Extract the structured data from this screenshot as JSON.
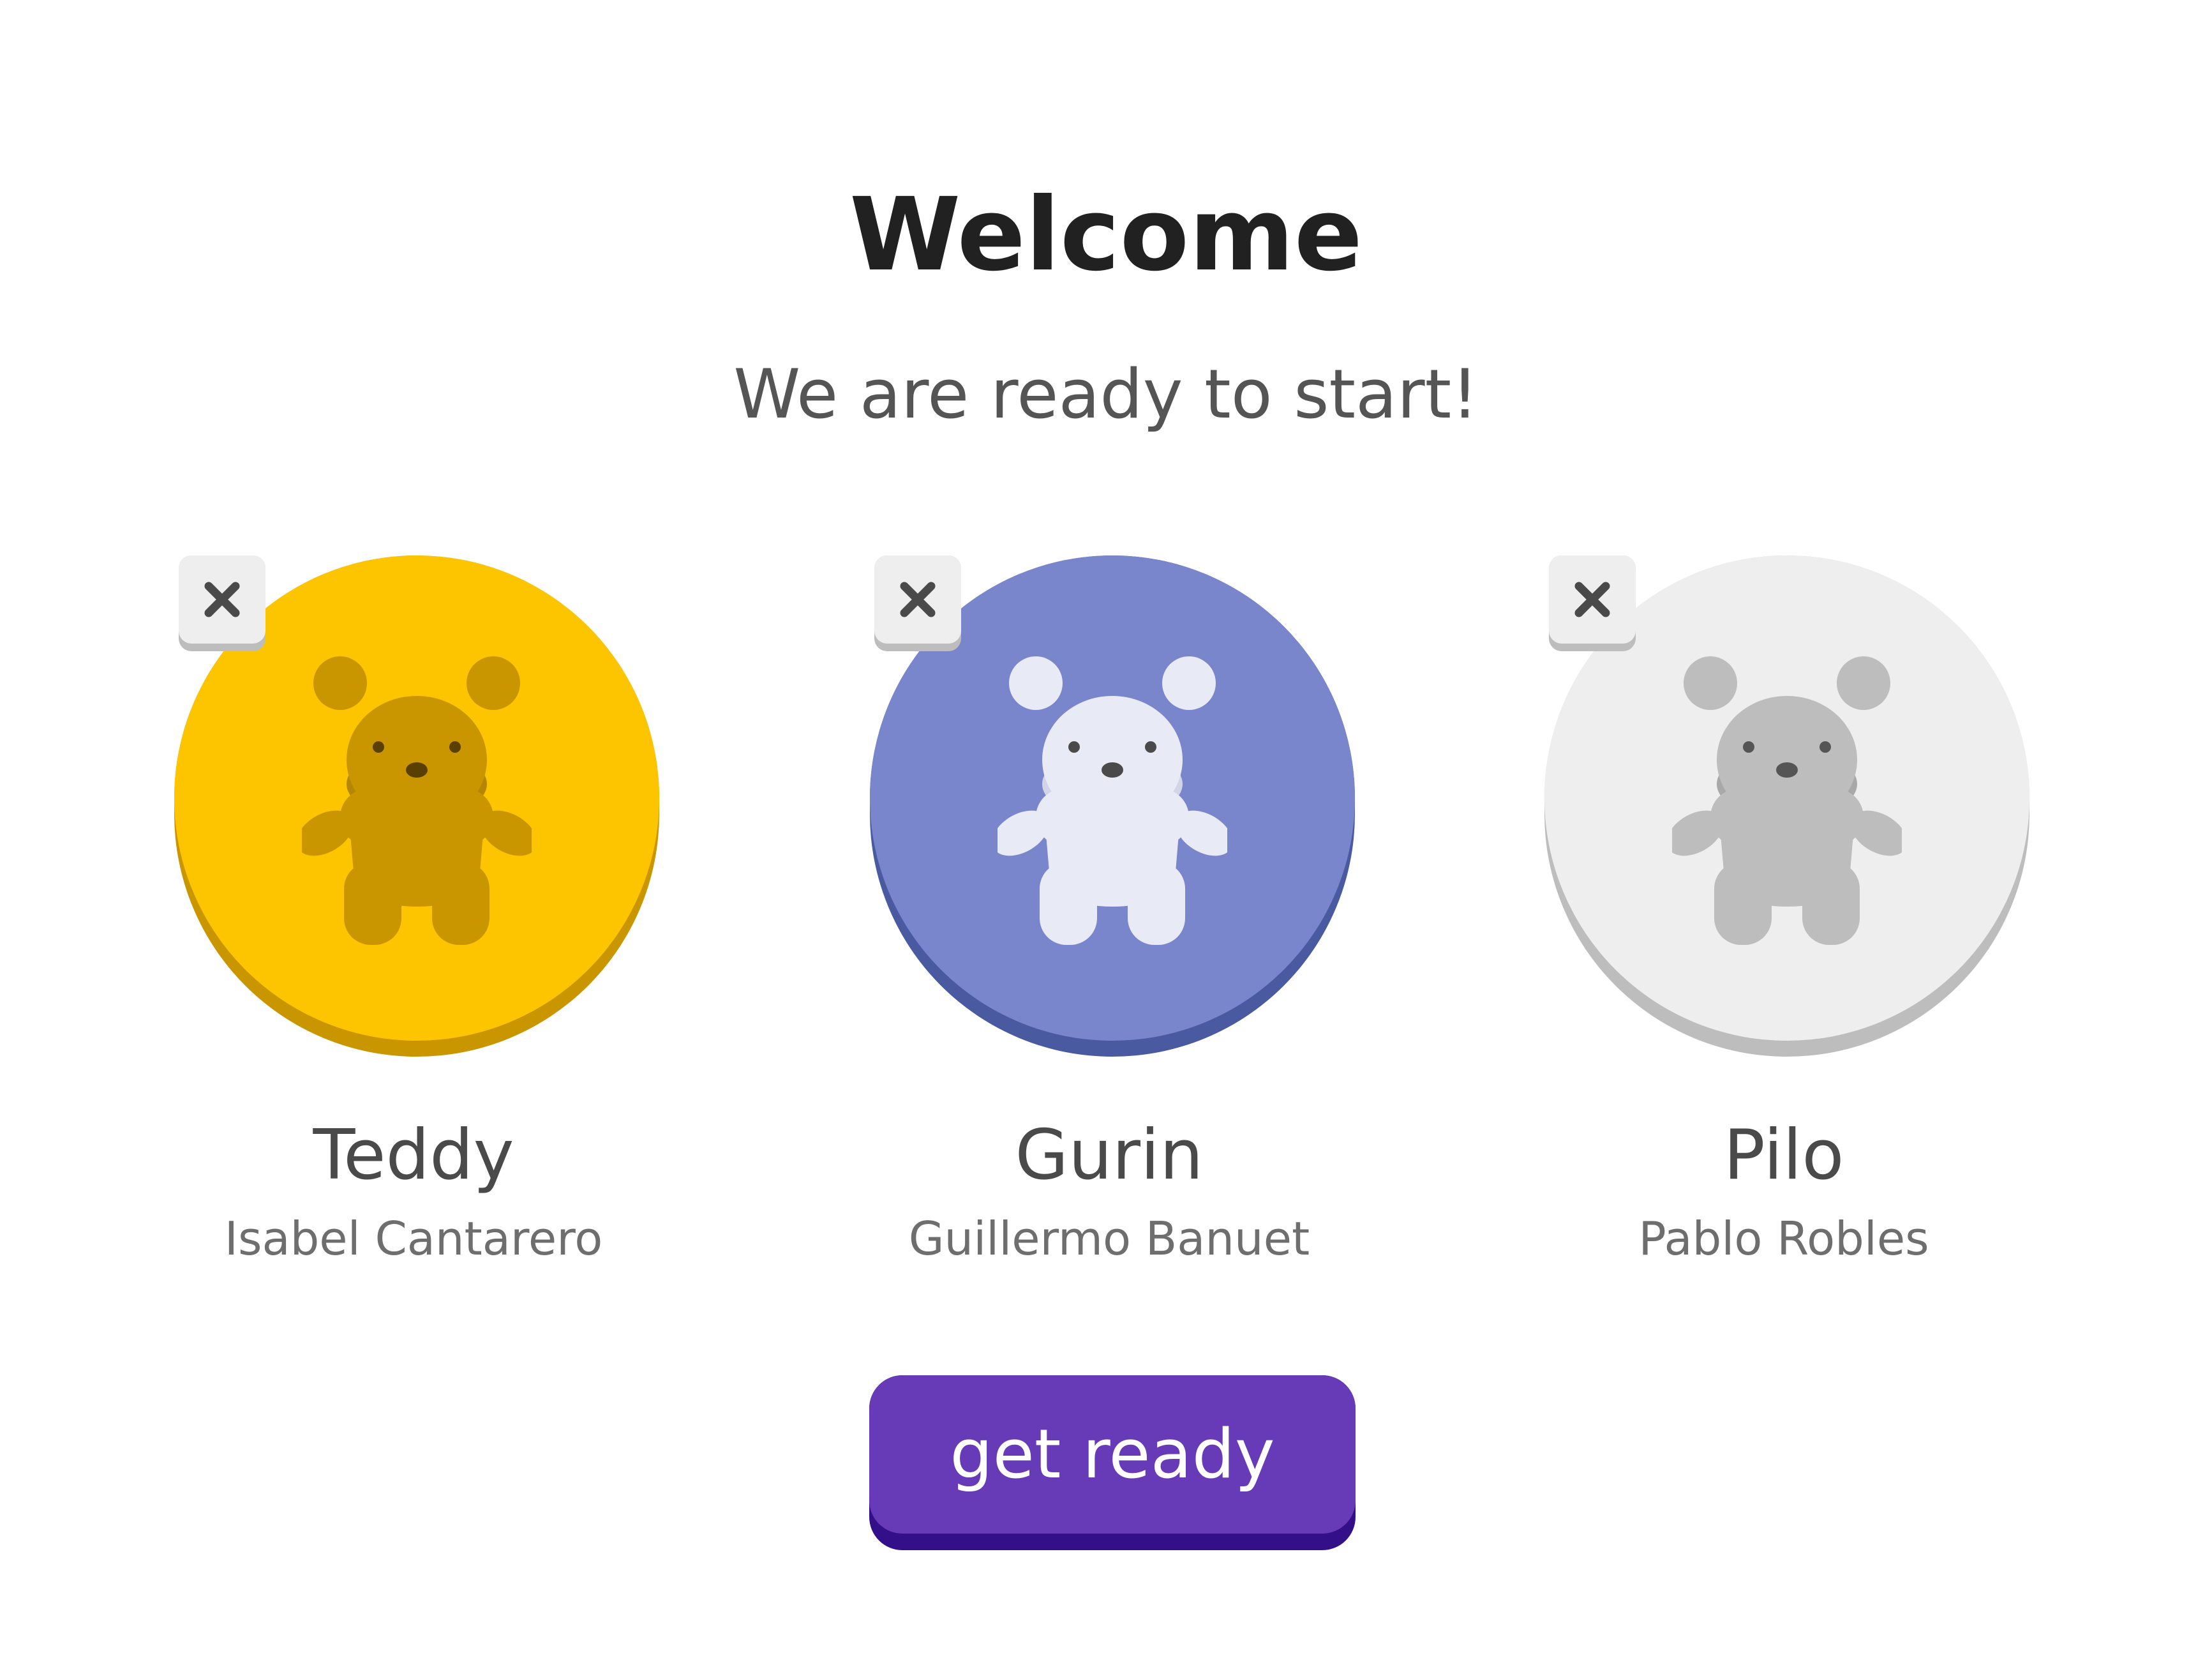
{
  "header": {
    "title": "Welcome",
    "subtitle": "We are ready to start!"
  },
  "players": [
    {
      "name": "Teddy",
      "owner": "Isabel Cantarero",
      "colors": {
        "face": "#fdc400",
        "shadow": "#c99600",
        "bear": "#c99600",
        "bear_shade": "#b58700",
        "features": "#5a4000"
      }
    },
    {
      "name": "Gurin",
      "owner": "Guillermo Banuet",
      "colors": {
        "face": "#7986cb",
        "shadow": "#4a5aa0",
        "bear": "#e8eaf6",
        "bear_shade": "#d2d5e8",
        "features": "#4a4a4a"
      }
    },
    {
      "name": "Pilo",
      "owner": "Pablo Robles",
      "colors": {
        "face": "#eeeeee",
        "shadow": "#bdbdbd",
        "bear": "#bdbdbd",
        "bear_shade": "#a8a8a8",
        "features": "#555555"
      }
    }
  ],
  "remove_icon": "close-icon",
  "avatar_icon": "teddy-bear-icon",
  "cta": {
    "label": "get ready",
    "color": "#673ab7",
    "shadow": "#33108a"
  }
}
